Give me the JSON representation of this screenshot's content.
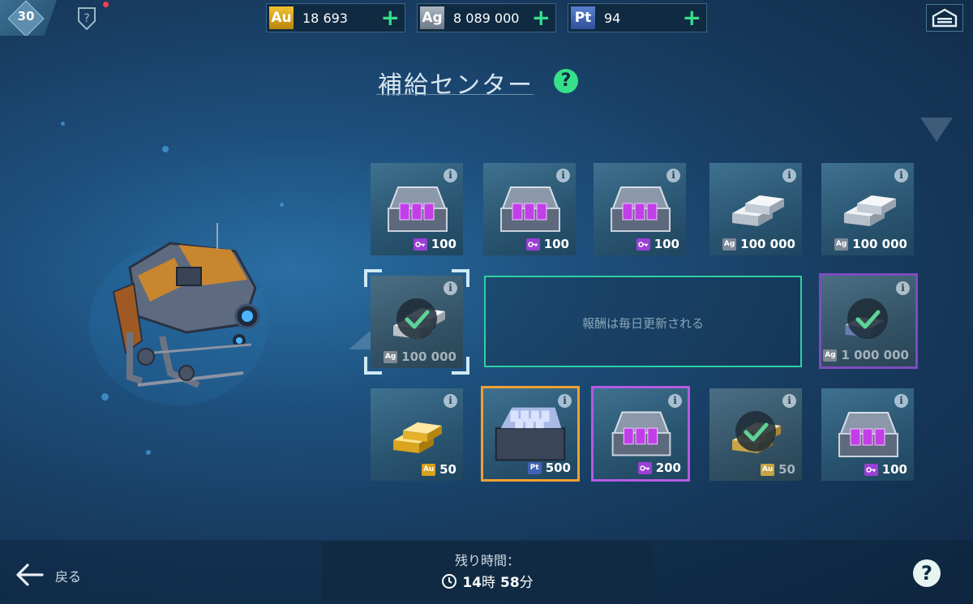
{
  "colors": {
    "accent_green": "#36e08a",
    "gold": "#d8a21c",
    "silver": "#8d99a6",
    "platinum": "#4062b4",
    "key_purple": "#9b3fd6",
    "selected_frame": "#cfeaf6",
    "purple_frame": "#8a45e6",
    "orange_frame": "#f0a033",
    "pink_frame": "#b35be0"
  },
  "header": {
    "level": "30",
    "currencies": [
      {
        "code": "Au",
        "value": "18 693",
        "color": "#d8a21c"
      },
      {
        "code": "Ag",
        "value": "8 089 000",
        "color": "#8d99a6"
      },
      {
        "code": "Pt",
        "value": "94",
        "color": "#4062b4"
      }
    ],
    "plus": "+"
  },
  "title": "補給センター",
  "help_glyph": "?",
  "info_glyph": "i",
  "message": "報酬は毎日更新される",
  "cards": [
    {
      "item": "key-chest",
      "currency": "key",
      "price": "100",
      "claimed": false
    },
    {
      "item": "key-chest",
      "currency": "key",
      "price": "100",
      "claimed": false
    },
    {
      "item": "key-chest",
      "currency": "key",
      "price": "100",
      "claimed": false
    },
    {
      "item": "silver-bars",
      "currency": "Ag",
      "price": "100 000",
      "claimed": false
    },
    {
      "item": "silver-bars",
      "currency": "Ag",
      "price": "100 000",
      "claimed": false
    },
    {
      "item": "silver-bars",
      "currency": "Ag",
      "price": "100 000",
      "claimed": true
    },
    {
      "item": "platinum-bars",
      "currency": "Ag",
      "price": "1 000 000",
      "claimed": true
    },
    {
      "item": "gold-bars",
      "currency": "Au",
      "price": "50",
      "claimed": false
    },
    {
      "item": "platinum-crate",
      "currency": "Pt",
      "price": "500",
      "claimed": false
    },
    {
      "item": "key-chest",
      "currency": "key",
      "price": "200",
      "claimed": false
    },
    {
      "item": "gold-bars",
      "currency": "Au",
      "price": "50",
      "claimed": true
    },
    {
      "item": "key-chest",
      "currency": "key",
      "price": "100",
      "claimed": false
    }
  ],
  "footer": {
    "back_label": "戻る",
    "timer_label": "残り時間：",
    "hours": "14",
    "hours_unit": "時",
    "minutes": "58",
    "minutes_unit": "分"
  }
}
